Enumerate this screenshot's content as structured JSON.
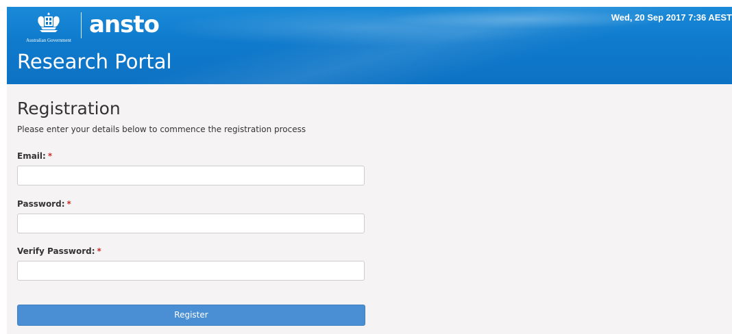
{
  "header": {
    "gov_text": "Australian Government",
    "logo_text": "ansto",
    "portal_title": "Research Portal",
    "datetime": "Wed, 20 Sep 2017 7:36 AEST",
    "icons": [
      "coat-of-arms-icon"
    ]
  },
  "form": {
    "title": "Registration",
    "intro": "Please enter your details below to commence the registration process",
    "required_marker": "*",
    "fields": [
      {
        "label": "Email:",
        "value": "",
        "placeholder": ""
      },
      {
        "label": "Password:",
        "value": "",
        "placeholder": ""
      },
      {
        "label": "Verify Password:",
        "value": "",
        "placeholder": ""
      }
    ],
    "register_label": "Register"
  },
  "colors": {
    "header_blue": "#0f7acc",
    "content_background": "#f6f3f5",
    "button_blue": "#4a8fd4",
    "required_red": "#c9302c"
  }
}
